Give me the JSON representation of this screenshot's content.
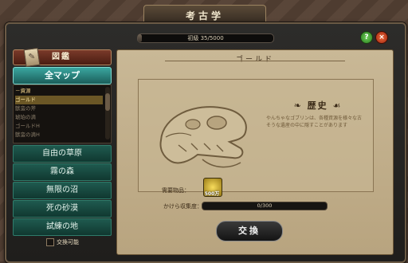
{
  "window": {
    "title": "考古学",
    "progress_text": "初級 35/5000",
    "progress_fraction": 0.007,
    "help_label": "?",
    "close_label": "×"
  },
  "sidebar": {
    "zukan_label": "図鑑",
    "all_map_label": "全マップ",
    "tree": [
      {
        "label": "－資源",
        "kind": "cat"
      },
      {
        "label": "ゴールド",
        "kind": "sel"
      },
      {
        "label": "獣蛮の斧",
        "kind": "item"
      },
      {
        "label": "琥珀の滴",
        "kind": "item"
      },
      {
        "label": "ゴールドH",
        "kind": "item"
      },
      {
        "label": "獣蛮の滴H",
        "kind": "item"
      }
    ],
    "regions": [
      "自由の草原",
      "霧の森",
      "無限の沼",
      "死の砂漠",
      "試練の地"
    ],
    "exchange_checkbox_label": "交換可能"
  },
  "main": {
    "title": "ゴールド",
    "history_heading": "歴史",
    "history_text": "やんちゃなゴブリンは、各種資源を様々な古そうな遺産の中に隠すことがあります",
    "required_label": "需要物品：",
    "required_item": {
      "icon": "gold-coin-icon",
      "quantity": "500万"
    },
    "fragment_label": "かけら収集度：",
    "fragment_text": "0/300",
    "exchange_button": "交換"
  }
}
